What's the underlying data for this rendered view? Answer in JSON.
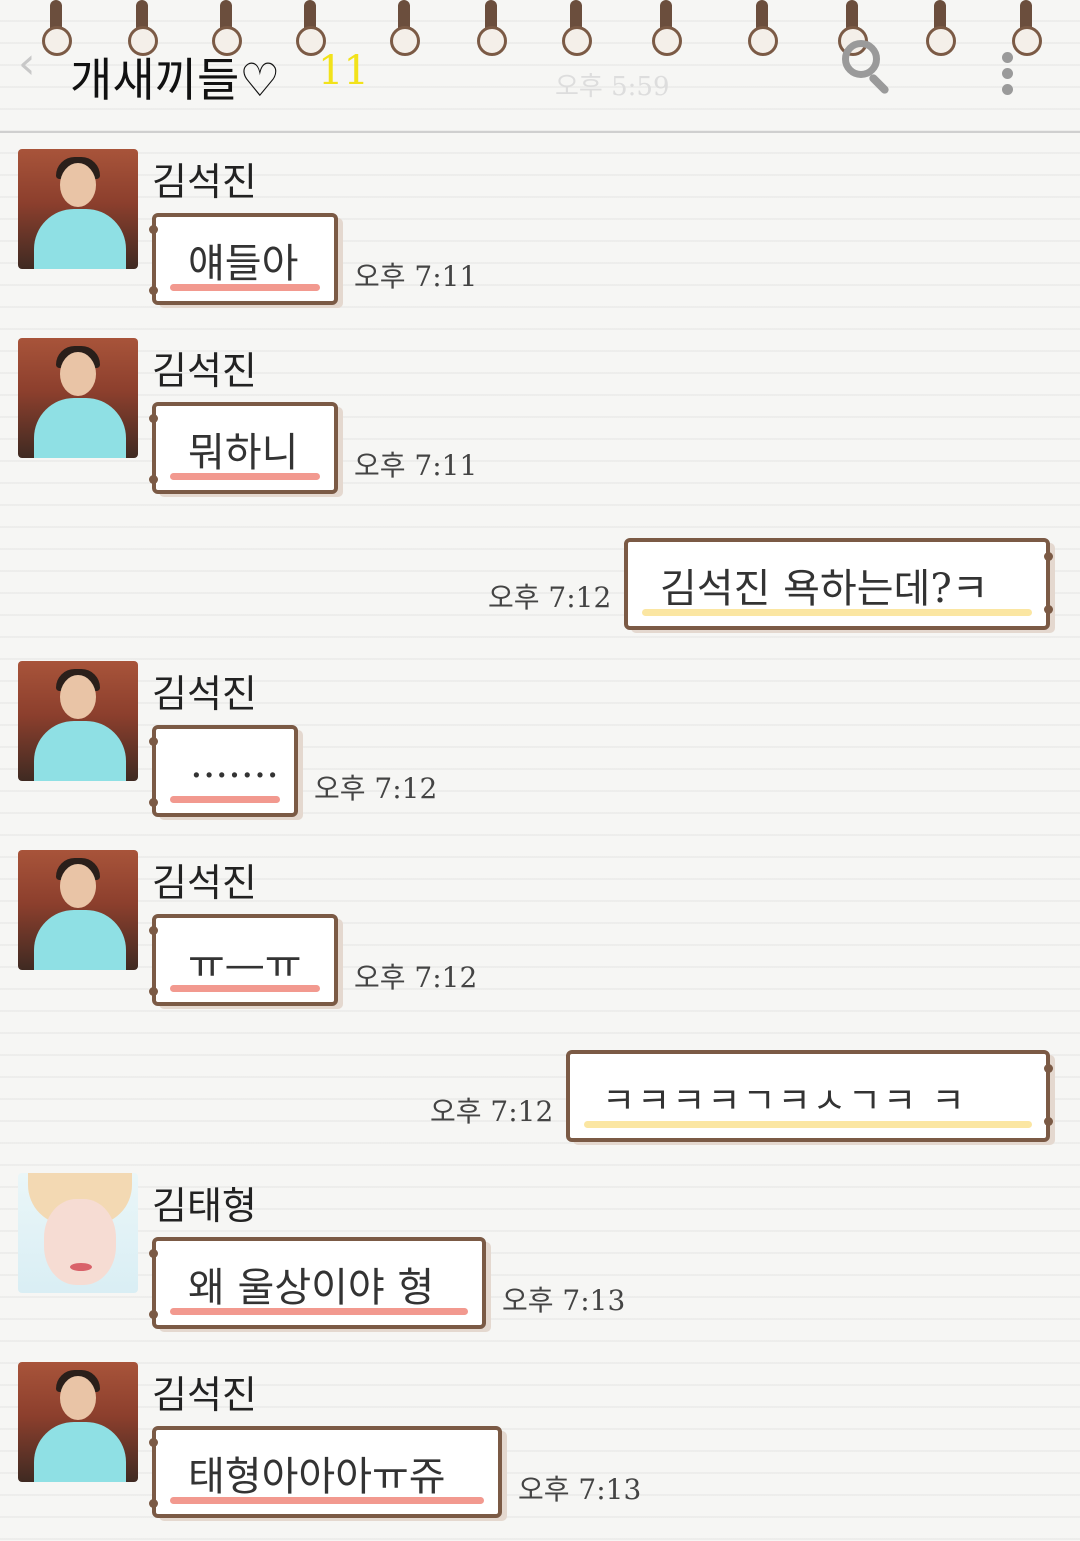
{
  "header": {
    "title": "개새끼들♡",
    "member_count": "11",
    "back_icon": "chevron-left-icon",
    "search_icon": "search-icon",
    "more_icon": "more-vert-icon",
    "background_ghost_text": "오후 5:59"
  },
  "colors": {
    "bubble_border": "#7b5a45",
    "left_underline": "#f2998f",
    "right_underline": "#fbe6a2",
    "count": "#f2e21a"
  },
  "messages": [
    {
      "sender": "김석진",
      "text": "얘들아",
      "time": "오후 7:11",
      "side": "left"
    },
    {
      "sender": "김석진",
      "text": "뭐하니",
      "time": "오후 7:11",
      "side": "left"
    },
    {
      "sender": "",
      "text": "김석진 욕하는데?ㅋ",
      "time": "오후 7:12",
      "side": "right"
    },
    {
      "sender": "김석진",
      "text": ".......",
      "time": "오후 7:12",
      "side": "left"
    },
    {
      "sender": "김석진",
      "text": "ㅠ—ㅠ",
      "time": "오후 7:12",
      "side": "left"
    },
    {
      "sender": "",
      "text": "ㅋㅋㅋㅋㄱㅋㅅㄱㅋ ㅋ",
      "time": "오후 7:12",
      "side": "right"
    },
    {
      "sender": "김태형",
      "text": "왜 울상이야 형",
      "time": "오후 7:13",
      "side": "left"
    },
    {
      "sender": "김석진",
      "text": "태형아아아ㅠ쥬",
      "time": "오후 7:13",
      "side": "left"
    }
  ]
}
